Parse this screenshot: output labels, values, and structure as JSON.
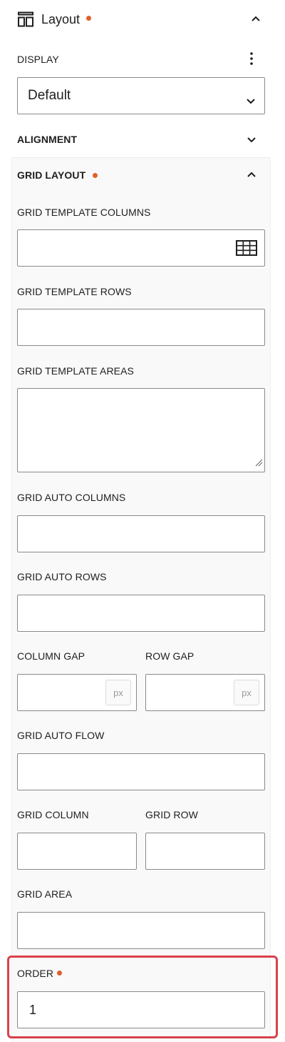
{
  "header": {
    "title": "Layout",
    "icon": "layout-icon",
    "collapse_icon": "chevron-up-icon"
  },
  "display": {
    "label": "DISPLAY",
    "menu_icon": "more-vertical-icon",
    "value": "Default"
  },
  "alignment": {
    "label": "ALIGNMENT",
    "toggle_icon": "chevron-down-icon"
  },
  "grid_layout": {
    "label": "GRID LAYOUT",
    "toggle_icon": "chevron-up-icon",
    "fields": {
      "template_columns": {
        "label": "GRID TEMPLATE COLUMNS",
        "value": "",
        "icon": "grid-table-icon"
      },
      "template_rows": {
        "label": "GRID TEMPLATE ROWS",
        "value": ""
      },
      "template_areas": {
        "label": "GRID TEMPLATE AREAS",
        "value": ""
      },
      "auto_columns": {
        "label": "GRID AUTO COLUMNS",
        "value": ""
      },
      "auto_rows": {
        "label": "GRID AUTO ROWS",
        "value": ""
      },
      "column_gap": {
        "label": "COLUMN GAP",
        "value": "",
        "unit": "px"
      },
      "row_gap": {
        "label": "ROW GAP",
        "value": "",
        "unit": "px"
      },
      "auto_flow": {
        "label": "GRID AUTO FLOW",
        "value": ""
      },
      "grid_column": {
        "label": "GRID COLUMN",
        "value": ""
      },
      "grid_row": {
        "label": "GRID ROW",
        "value": ""
      },
      "grid_area": {
        "label": "GRID AREA",
        "value": ""
      }
    }
  },
  "order": {
    "label": "ORDER",
    "value": "1"
  },
  "colors": {
    "modified_dot": "#e0602a",
    "highlight_border": "#d9414b",
    "section_bg": "#f9f9f9"
  }
}
